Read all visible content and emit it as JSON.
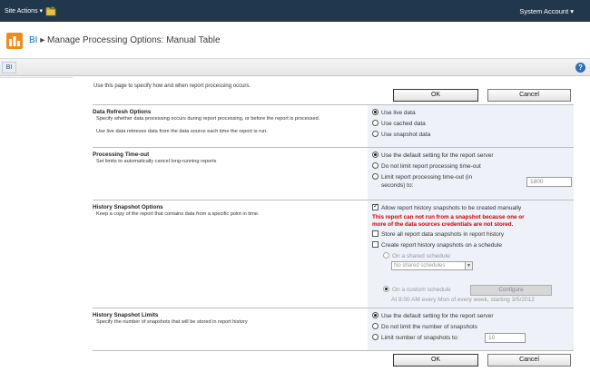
{
  "topbar": {
    "site_actions": "Site Actions ▾",
    "account": "System Account ▾"
  },
  "header": {
    "site": "BI",
    "separator": "▸",
    "title": "Manage Processing Options: Manual Table"
  },
  "nav": {
    "tab": "BI",
    "help": "?"
  },
  "intro": "Use this page to specify how and when report processing occurs.",
  "buttons": {
    "ok": "OK",
    "cancel": "Cancel"
  },
  "data_refresh": {
    "title": "Data Refresh Options",
    "desc1": "Specify whether data processing occurs during report processing, or before the report is processed.",
    "desc2": "Use live data retrieves data from the data source each time the report is run.",
    "options": [
      "Use live data",
      "Use cached data",
      "Use snapshot data"
    ]
  },
  "timeout": {
    "title": "Processing Time-out",
    "desc": "Set limits to automatically cancel long-running reports",
    "options": [
      "Use the default setting for the report server",
      "Do not limit report processing time-out",
      "Limit report processing time-out (in"
    ],
    "option3_line2": "seconds) to:",
    "value": "1800"
  },
  "history": {
    "title": "History Snapshot Options",
    "desc": "Keep a copy of the report that contains data from a specific point in time.",
    "allow": "Allow report history snapshots to be created manually",
    "warning1": "This report can not run from a snapshot because one or",
    "warning2": "more of the data sources credentials are not stored.",
    "store": "Store all report data snapshots in report history",
    "create": "Create report history snapshots on a schedule",
    "shared": "On a shared schedule:",
    "shared_select": "No shared schedules",
    "custom": "On a custom schedule",
    "configure": "Configure",
    "schedule_text": "At 8:00 AM every Mon of every week, starting 3/5/2012"
  },
  "limits": {
    "title": "History Snapshot Limits",
    "desc": "Specify the number of snapshots that will be stored in report history",
    "options": [
      "Use the default setting for the report server",
      "Do not limit the number of snapshots",
      "Limit number of snapshots to:"
    ],
    "value": "10"
  }
}
